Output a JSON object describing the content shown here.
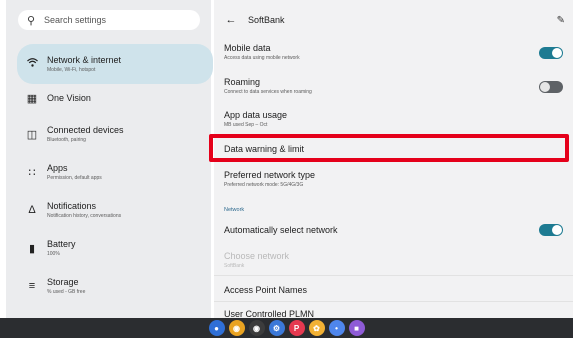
{
  "search": {
    "placeholder": "Search settings"
  },
  "sidebar": {
    "items": [
      {
        "title": "Network & internet",
        "subtitle": "Mobile, Wi-Fi, hotspot",
        "icon": "wifi-icon",
        "selected": true
      },
      {
        "title": "One Vision",
        "subtitle": "",
        "icon": "grid-icon"
      },
      {
        "title": "Connected devices",
        "subtitle": "Bluetooth, pairing",
        "icon": "devices-icon"
      },
      {
        "title": "Apps",
        "subtitle": "Permission, default apps",
        "icon": "apps-icon"
      },
      {
        "title": "Notifications",
        "subtitle": "Notification history, conversations",
        "icon": "bell-icon"
      },
      {
        "title": "Battery",
        "subtitle": "100%",
        "icon": "battery-icon"
      },
      {
        "title": "Storage",
        "subtitle": "% used - GB free",
        "icon": "storage-icon"
      }
    ]
  },
  "header": {
    "title": "SoftBank"
  },
  "rows": {
    "mobile_data": {
      "title": "Mobile data",
      "subtitle": "Access data using mobile network",
      "toggle": true
    },
    "roaming": {
      "title": "Roaming",
      "subtitle": "Connect to data services when roaming",
      "toggle": false
    },
    "app_data_usage": {
      "title": "App data usage",
      "subtitle": "MB used Sep – Oct"
    },
    "data_warning": {
      "title": "Data warning & limit"
    },
    "preferred_network": {
      "title": "Preferred network type",
      "subtitle": "Preferred network mode: 5G/4G/3G"
    },
    "section_network": "Network",
    "auto_select": {
      "title": "Automatically select network",
      "toggle": true
    },
    "choose_network": {
      "title": "Choose network",
      "subtitle": "SoftBank"
    },
    "apn": {
      "title": "Access Point Names"
    },
    "user_plmn": {
      "title": "User Controlled PLMN"
    }
  },
  "colors": {
    "accent": "#1e7b92",
    "highlight": "#e5001a",
    "selected_bg": "#cfe3eb"
  },
  "dock": {
    "apps": [
      {
        "name": "launcher-icon",
        "color": "#2f6fd6"
      },
      {
        "name": "chrome-icon",
        "color": "#e9a322"
      },
      {
        "name": "camera-icon",
        "color": "#3c3c3c"
      },
      {
        "name": "settings-app-icon",
        "color": "#3b78d8"
      },
      {
        "name": "app-p-icon",
        "color": "#e53950"
      },
      {
        "name": "photos-icon",
        "color": "#f2b134"
      },
      {
        "name": "assistant-icon",
        "color": "#4f86ec"
      },
      {
        "name": "app-extra-icon",
        "color": "#8e5bd6"
      }
    ]
  }
}
